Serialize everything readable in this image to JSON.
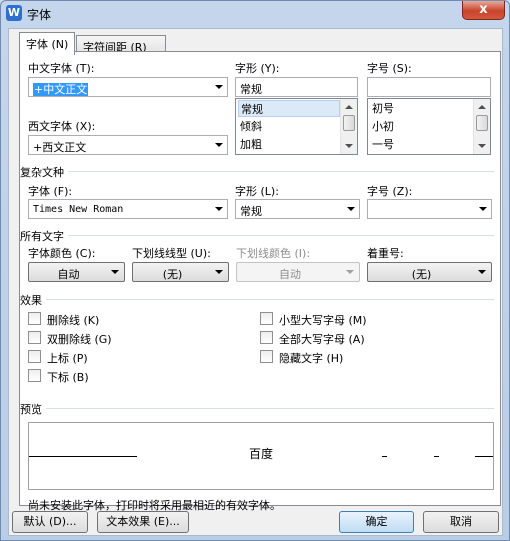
{
  "window": {
    "title": "字体",
    "icon": "wps-writer-app-icon",
    "close_label": "x"
  },
  "tabs": [
    {
      "label": "字体 (N)"
    },
    {
      "label": "字符间距 (R)"
    }
  ],
  "chinese_font": {
    "label": "中文字体 (T):",
    "value": "+中文正文"
  },
  "western_font": {
    "label": "西文字体 (X):",
    "value": "+西文正文"
  },
  "font_style": {
    "label": "字形 (Y):",
    "value": "常规",
    "options": [
      "常规",
      "倾斜",
      "加粗"
    ]
  },
  "font_size": {
    "label": "字号 (S):",
    "value": "",
    "options": [
      "初号",
      "小初",
      "一号"
    ]
  },
  "complex": {
    "section": "复杂文种",
    "font_label": "字体 (F):",
    "font_value": "Times New Roman",
    "style_label": "字形 (L):",
    "style_value": "常规",
    "size_label": "字号 (Z):",
    "size_value": ""
  },
  "all_text": {
    "section": "所有文字",
    "color_label": "字体颜色 (C):",
    "color_value": "自动",
    "underline_label": "下划线线型 (U):",
    "underline_value": "(无)",
    "underline_color_label": "下划线颜色 (I):",
    "underline_color_value": "自动",
    "emphasis_label": "着重号:",
    "emphasis_value": "(无)"
  },
  "effects": {
    "section": "效果",
    "left": [
      "删除线 (K)",
      "双删除线 (G)",
      "上标 (P)",
      "下标 (B)"
    ],
    "right": [
      "小型大写字母 (M)",
      "全部大写字母 (A)",
      "隐藏文字 (H)"
    ]
  },
  "preview": {
    "section": "预览",
    "text": "百度"
  },
  "note": "尚未安装此字体，打印时将采用最相近的有效字体。",
  "buttons": {
    "default": "默认 (D)...",
    "text_effect": "文本效果 (E)...",
    "ok": "确定",
    "cancel": "取消"
  }
}
